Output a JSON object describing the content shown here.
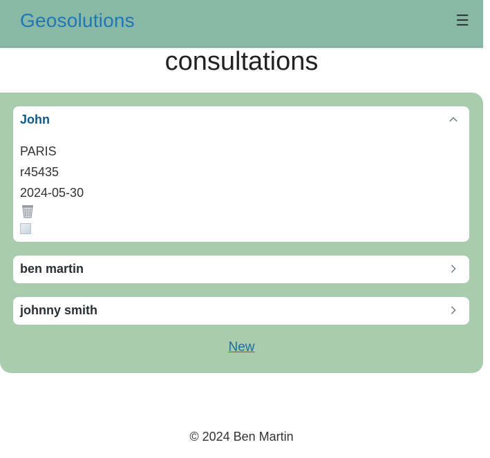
{
  "navbar": {
    "brand": "Geosolutions",
    "toggle_icon": "hamburger-menu-icon",
    "toggle_glyph": "☰"
  },
  "page": {
    "title": "consultations"
  },
  "colors": {
    "navbar_bg": "#89b8a7",
    "panel_bg": "#a9ccaf",
    "brand": "#1f77b4",
    "link": "#1f6f9c"
  },
  "consultations": [
    {
      "name": "John",
      "expanded": true,
      "city": "PARIS",
      "reference": "r45435",
      "date": "2024-05-30",
      "icons": [
        "trash-icon",
        "broken-image-icon"
      ]
    },
    {
      "name": "ben martin",
      "expanded": false
    },
    {
      "name": "johnny smith",
      "expanded": false
    }
  ],
  "actions": {
    "new_label": "New"
  },
  "footer": {
    "text": "© 2024 Ben Martin"
  }
}
